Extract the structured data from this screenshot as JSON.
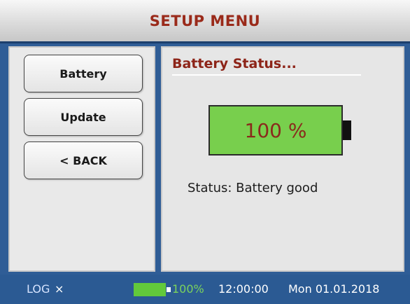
{
  "header": {
    "title": "SETUP MENU"
  },
  "menu": {
    "items": [
      {
        "label": "Battery"
      },
      {
        "label": "Update"
      },
      {
        "label": "< BACK"
      }
    ]
  },
  "battery_status": {
    "title": "Battery Status...",
    "percent_text": "100 %",
    "level": 1.0,
    "status_text": "Status: Battery good"
  },
  "footer": {
    "log_label": "LOG",
    "log_icon": "close-icon",
    "battery_percent": "100%",
    "time": "12:00:00",
    "date": "Mon 01.01.2018"
  },
  "colors": {
    "header_text": "#9a2a1a",
    "battery_fill": "#78cf4d",
    "footer_bg": "#2b5a93",
    "footer_percent": "#7bd35c"
  }
}
